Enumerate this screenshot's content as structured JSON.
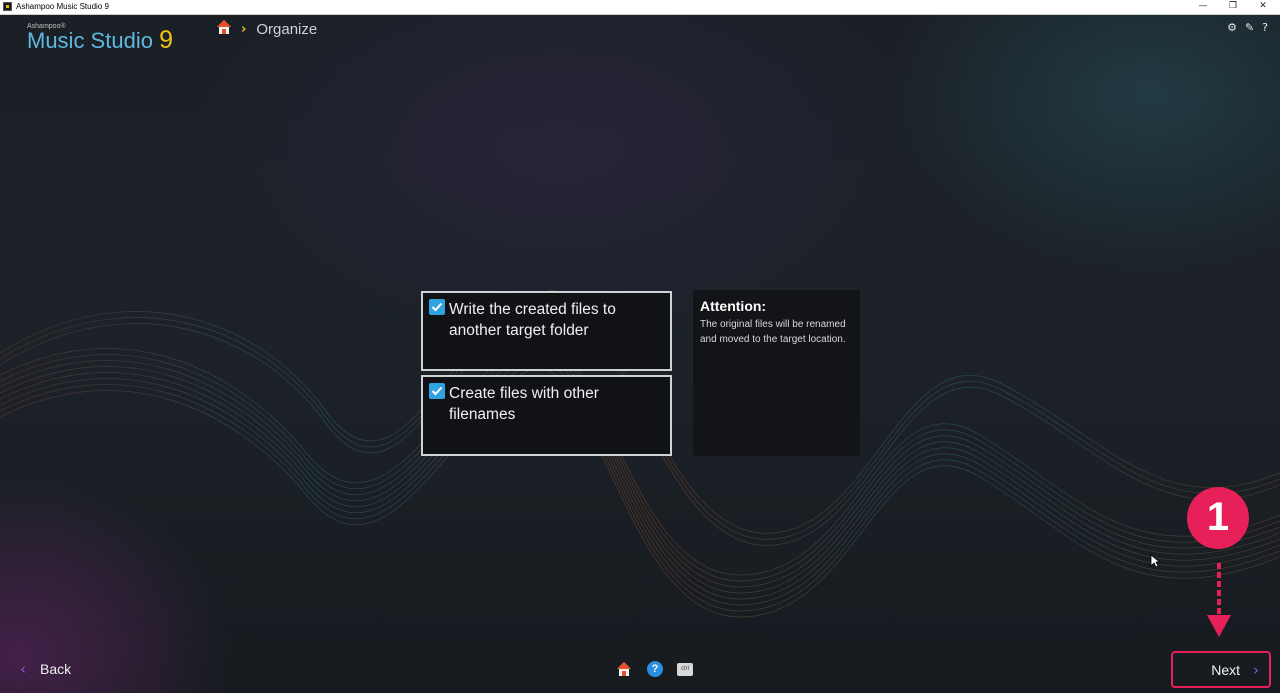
{
  "window": {
    "title": "Ashampoo Music Studio 9",
    "minimize_glyph": "—",
    "restore_glyph": "❐",
    "close_glyph": "✕"
  },
  "logo": {
    "brand": "Ashampoo®",
    "product": "Music Studio",
    "version": "9"
  },
  "breadcrumb": {
    "home_icon": "home-icon",
    "separator": "›",
    "current": "Organize"
  },
  "top_icons": {
    "settings": "⚙",
    "feedback": "✎",
    "help": "?"
  },
  "options": [
    {
      "label": "Write the created files to another target folder",
      "checked": true
    },
    {
      "label": "Create files with other filenames",
      "checked": true
    }
  ],
  "attention": {
    "title": "Attention:",
    "text": "The original files will be renamed and moved to the target location."
  },
  "footer": {
    "back_label": "Back",
    "next_label": "Next",
    "back_chevron": "‹",
    "next_chevron": "›",
    "help_glyph": "?",
    "ctrl_label": "ctrl"
  },
  "annotation": {
    "step_number": "1",
    "color": "#e8205a"
  },
  "colors": {
    "accent_blue": "#2ea3e0",
    "accent_yellow": "#f2c214",
    "chevron_purple": "#8b55d8"
  }
}
